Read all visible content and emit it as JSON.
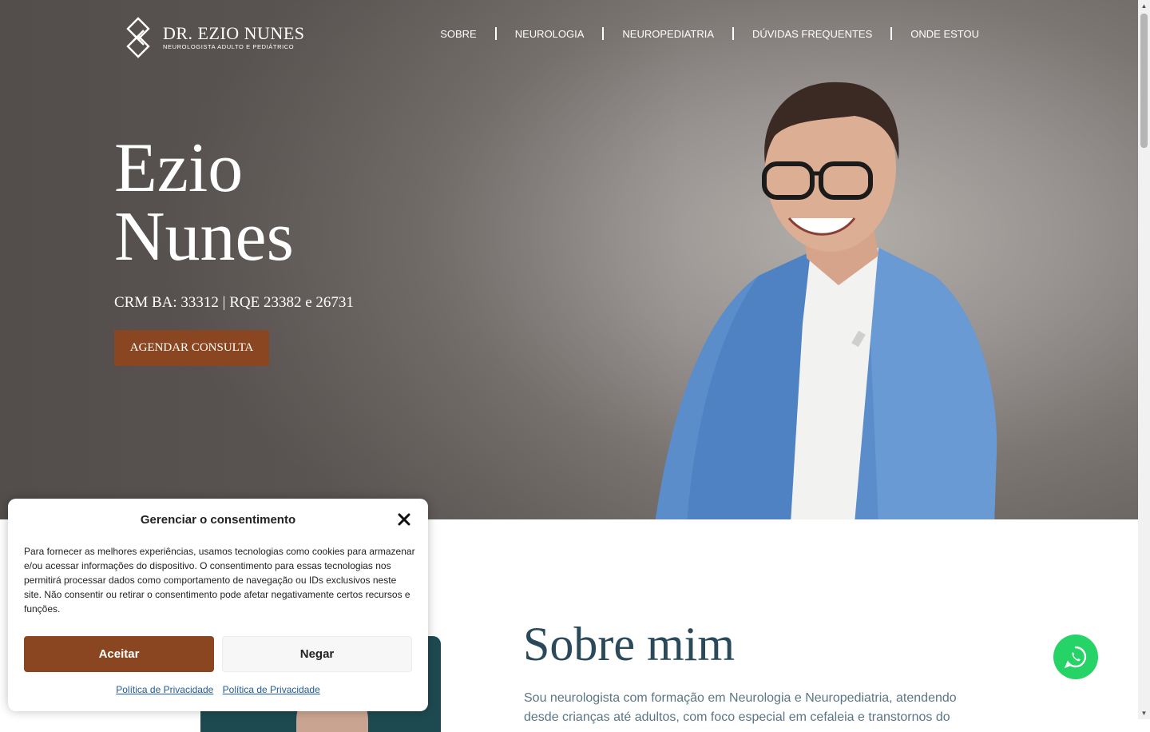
{
  "brand": {
    "name": "DR. EZIO NUNES",
    "tagline": "NEUROLOGISTA ADULTO E PEDIÁTRICO"
  },
  "nav": {
    "items": [
      {
        "label": "SOBRE"
      },
      {
        "label": "NEUROLOGIA"
      },
      {
        "label": "NEUROPEDIATRIA"
      },
      {
        "label": "DÚVIDAS FREQUENTES"
      },
      {
        "label": "ONDE ESTOU"
      }
    ]
  },
  "hero": {
    "first_name": "Ezio",
    "last_name": "Nunes",
    "credentials": "CRM BA: 33312 | RQE 23382 e 26731",
    "cta_label": "AGENDAR CONSULTA"
  },
  "about": {
    "title": "Sobre mim",
    "text": "Sou neurologista com formação em Neurologia e Neuropediatria, atendendo desde crianças até adultos, com foco especial em cefaleia e transtornos do"
  },
  "consent": {
    "title": "Gerenciar o consentimento",
    "text": "Para fornecer as melhores experiências, usamos tecnologias como cookies para armazenar e/ou acessar informações do dispositivo. O consentimento para essas tecnologias nos permitirá processar dados como comportamento de navegação ou IDs exclusivos neste site. Não consentir ou retirar o consentimento pode afetar negativamente certos recursos e funções.",
    "accept_label": "Aceitar",
    "deny_label": "Negar",
    "privacy_link_1": "Política de Privacidade",
    "privacy_link_2": "Política de Privacidade"
  },
  "icons": {
    "logo": "knot-logo-icon",
    "close": "close-icon",
    "whatsapp": "whatsapp-icon"
  },
  "colors": {
    "accent": "#8a4620",
    "heading": "#2a4a5c",
    "whatsapp": "#25d366"
  }
}
